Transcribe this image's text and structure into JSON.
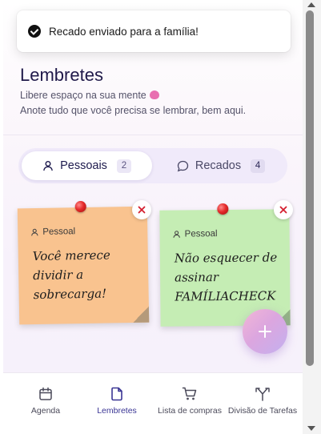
{
  "toast": {
    "message": "Recado enviado para a família!"
  },
  "header": {
    "title": "Lembretes",
    "subtitle": "Libere espaço na sua mente",
    "description": "Anote tudo que você precisa se lembrar, bem aqui."
  },
  "tabs": [
    {
      "label": "Pessoais",
      "count": "2",
      "active": true,
      "icon": "user-icon"
    },
    {
      "label": "Recados",
      "count": "4",
      "active": false,
      "icon": "message-icon"
    }
  ],
  "notes": [
    {
      "tag": "Pessoal",
      "text": "Você merece dividir a sobrecarga!",
      "color": "#f9c38f"
    },
    {
      "tag": "Pessoal",
      "text": "Não esquecer de assinar FAMÍLIACHECK",
      "color": "#c5edb4"
    }
  ],
  "nav": [
    {
      "label": "Agenda",
      "icon": "calendar-icon",
      "active": false
    },
    {
      "label": "Lembretes",
      "icon": "file-icon",
      "active": true
    },
    {
      "label": "Lista de compras",
      "icon": "cart-icon",
      "active": false
    },
    {
      "label": "Divisão de Tarefas",
      "icon": "split-arrows-icon",
      "active": false
    }
  ],
  "colors": {
    "accent": "#3a3594",
    "pin": "#e52a2a",
    "tab_bg": "#f0eafa"
  }
}
